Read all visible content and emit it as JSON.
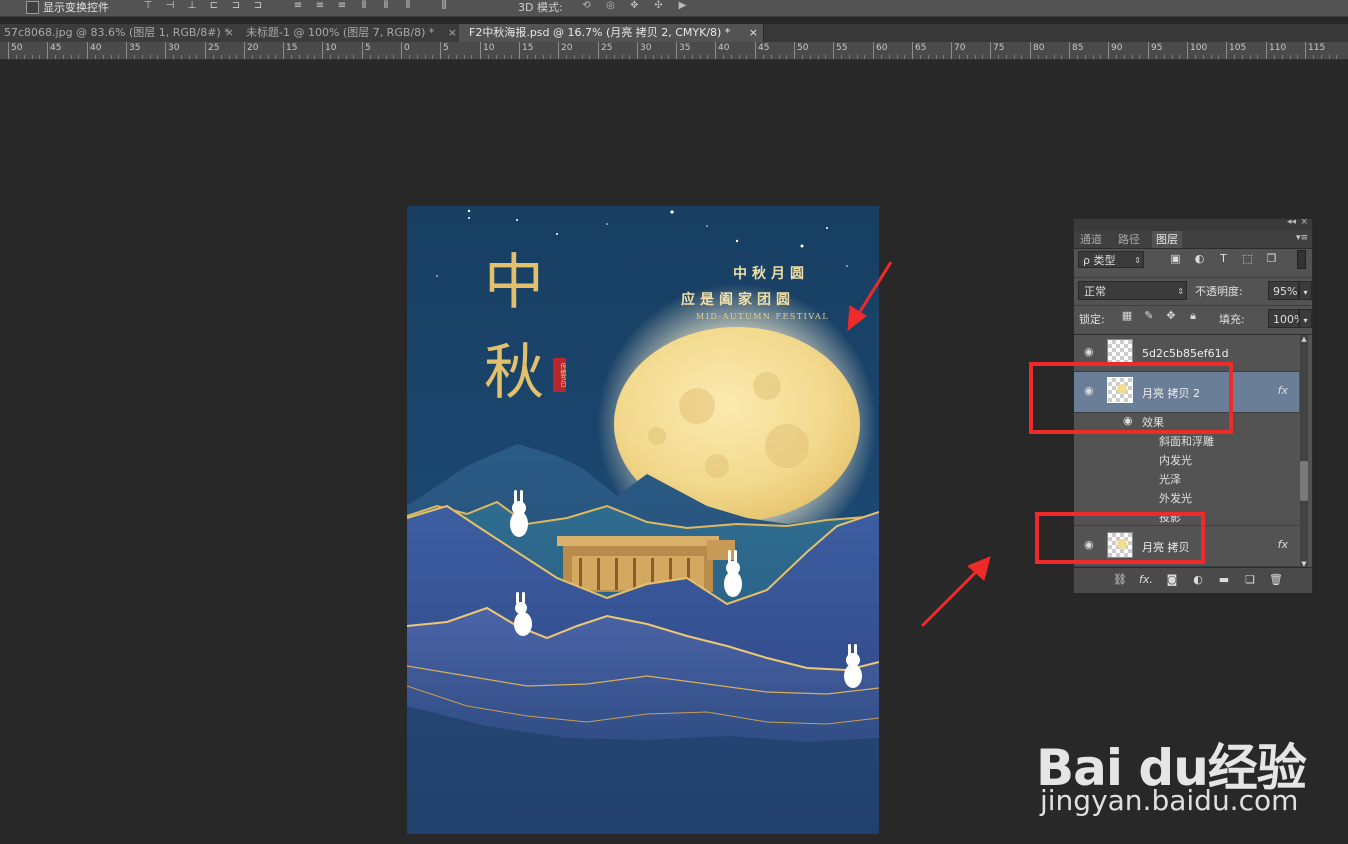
{
  "options_bar": {
    "show_transform_controls_label": "显示变换控件",
    "mode_3d_label": "3D 模式:"
  },
  "doc_tabs": [
    {
      "label": "57c8068.jpg @ 83.6% (图层 1, RGB/8#) *",
      "close": "×"
    },
    {
      "label": "未标题-1 @ 100% (图层 7, RGB/8) *",
      "close": "×"
    },
    {
      "label": "F2中秋海报.psd @ 16.7% (月亮 拷贝 2, CMYK/8) *",
      "close": "×"
    }
  ],
  "ruler_labels": [
    "50",
    "45",
    "40",
    "35",
    "30",
    "25",
    "20",
    "15",
    "10",
    "5",
    "0",
    "5",
    "10",
    "15",
    "20",
    "25",
    "30",
    "35",
    "40",
    "45",
    "50",
    "55",
    "60",
    "65",
    "70",
    "75",
    "80",
    "85",
    "90",
    "95",
    "100",
    "105",
    "110",
    "115"
  ],
  "poster": {
    "title_line1": "中",
    "title_line2": "秋",
    "seal_text": "传统节日",
    "headline1": "中秋月圆",
    "headline2": "应是阖家团圆",
    "subtitle": "MID-AUTUMN FESTIVAL"
  },
  "layers_panel": {
    "tabs": [
      "通道",
      "路径",
      "图层"
    ],
    "active_tab": "图层",
    "filter_label": "ρ 类型",
    "blend_mode": "正常",
    "opacity_label": "不透明度:",
    "opacity_value": "95%",
    "lock_label": "锁定:",
    "fill_label": "填充:",
    "fill_value": "100%",
    "layers": [
      {
        "name": "5d2c5b85ef61d",
        "selected": false,
        "fx": ""
      },
      {
        "name": "月亮 拷贝 2",
        "selected": true,
        "fx": "fx"
      },
      {
        "name": "月亮 拷贝",
        "selected": false,
        "fx": "fx"
      }
    ],
    "effects_label": "效果",
    "effects": [
      "斜面和浮雕",
      "内发光",
      "光泽",
      "外发光",
      "投影"
    ]
  },
  "watermark": {
    "logo_text": "Bai du经验",
    "url": "jingyan.baidu.com"
  },
  "colors": {
    "canvas_bg": "#282828",
    "panel_bg": "#535353",
    "selected_layer": "#6b7e98",
    "highlight_red": "#ee2a2a",
    "poster_gold": "#e3c06b"
  }
}
